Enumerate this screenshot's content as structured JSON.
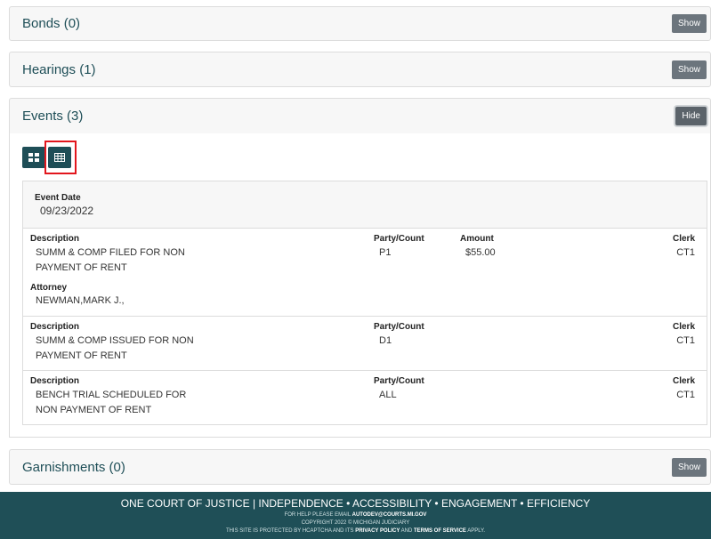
{
  "panels": {
    "bonds": {
      "title": "Bonds (0)",
      "button": "Show"
    },
    "hearings": {
      "title": "Hearings (1)",
      "button": "Show"
    },
    "events": {
      "title": "Events (3)",
      "button": "Hide"
    },
    "garnishments": {
      "title": "Garnishments (0)",
      "button": "Show"
    }
  },
  "events": {
    "event_date_label": "Event Date",
    "event_date": "09/23/2022",
    "rows": [
      {
        "description_label": "Description",
        "description_line1": "SUMM & COMP FILED FOR NON",
        "description_line2": "PAYMENT OF RENT",
        "party_label": "Party/Count",
        "party": "P1",
        "amount_label": "Amount",
        "amount": "$55.00",
        "clerk_label": "Clerk",
        "clerk": "CT1",
        "attorney_label": "Attorney",
        "attorney": "NEWMAN,MARK J.,"
      },
      {
        "description_label": "Description",
        "description_line1": "SUMM & COMP ISSUED FOR NON",
        "description_line2": "PAYMENT OF RENT",
        "party_label": "Party/Count",
        "party": "D1",
        "clerk_label": "Clerk",
        "clerk": "CT1"
      },
      {
        "description_label": "Description",
        "description_line1": "BENCH TRIAL SCHEDULED FOR",
        "description_line2": "NON PAYMENT OF RENT",
        "party_label": "Party/Count",
        "party": "ALL",
        "clerk_label": "Clerk",
        "clerk": "CT1"
      }
    ]
  },
  "footer": {
    "tagline": "ONE COURT OF JUSTICE | INDEPENDENCE • ACCESSIBILITY • ENGAGEMENT • EFFICIENCY",
    "help_prefix": "FOR HELP PLEASE EMAIL",
    "help_email": "AUTODEV@COURTS.MI.GOV",
    "copyright": "COPYRIGHT 2022 © MICHIGAN JUDICIARY",
    "captcha_prefix": "THIS SITE IS PROTECTED BY HCAPTCHA AND ITS",
    "privacy": "PRIVACY POLICY",
    "and": "AND",
    "terms": "TERMS OF SERVICE",
    "apply": "APPLY."
  },
  "icons": {
    "grid_view": "grid-view-icon",
    "table_view": "table-view-icon"
  },
  "colors": {
    "accent": "#1e4e57",
    "footer_bg": "#1f4f57",
    "highlight": "#e2161d"
  }
}
